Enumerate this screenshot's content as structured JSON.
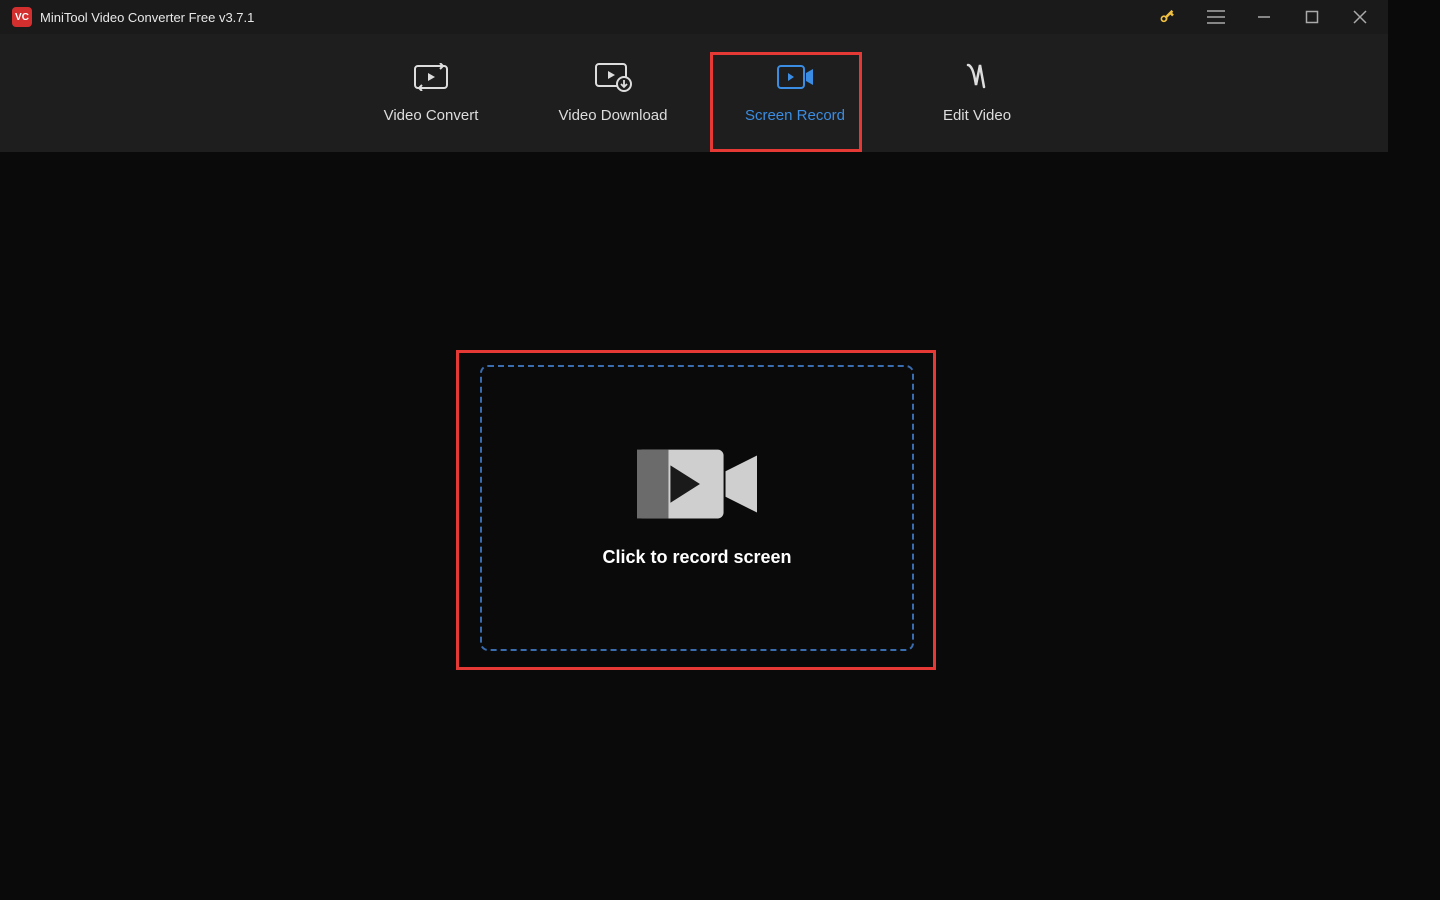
{
  "titlebar": {
    "app_icon_text": "VC",
    "title": "MiniTool Video Converter Free v3.7.1"
  },
  "nav": {
    "items": [
      {
        "label": "Video Convert"
      },
      {
        "label": "Video Download"
      },
      {
        "label": "Screen Record"
      },
      {
        "label": "Edit Video"
      }
    ],
    "active_index": 2
  },
  "main": {
    "record_prompt": "Click to record screen"
  },
  "colors": {
    "accent": "#3a8de2",
    "highlight": "#e53935",
    "dashed_border": "#3a6db0"
  }
}
